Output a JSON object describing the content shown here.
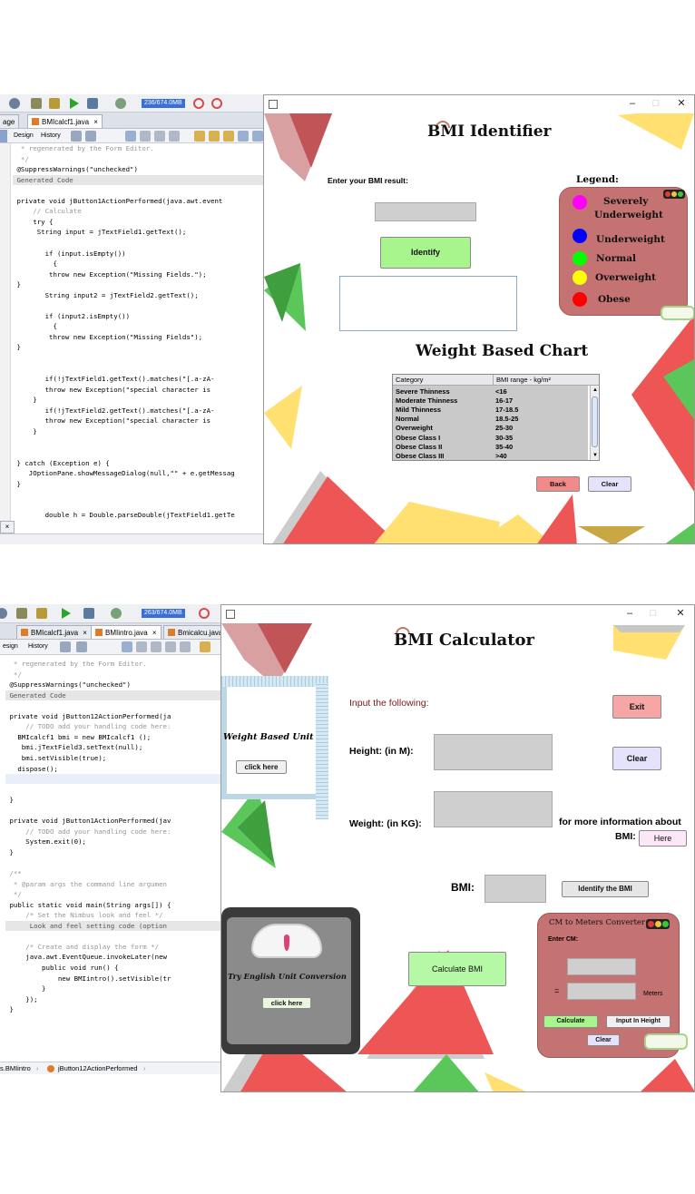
{
  "ide_top": {
    "memory": "236/674.0MB",
    "tab_active": "BMIcalcf1.java",
    "sub_design": "Design",
    "sub_history": "History",
    "tab_prefix": "age",
    "close_glyph": "×",
    "code": [
      {
        "t": "  * regenerated by the Form Editor.",
        "c": "cm"
      },
      {
        "t": "  */",
        "c": "cm"
      },
      {
        "t": " @SuppressWarnings(\"unchecked\")"
      },
      {
        "t": " Generated Code",
        "c": "fold"
      },
      {
        "t": ""
      },
      {
        "t": " private void jButton1ActionPerformed(java.awt.event"
      },
      {
        "t": "     // Calculate",
        "c": "cm"
      },
      {
        "t": "     try {"
      },
      {
        "t": "      String input = jTextField1.getText();"
      },
      {
        "t": ""
      },
      {
        "t": "        if (input.isEmpty())"
      },
      {
        "t": "          {"
      },
      {
        "t": "         throw new Exception(\"Missing Fields.\");"
      },
      {
        "t": " }"
      },
      {
        "t": "        String input2 = jTextField2.getText();"
      },
      {
        "t": ""
      },
      {
        "t": "        if (input2.isEmpty())"
      },
      {
        "t": "          {"
      },
      {
        "t": "         throw new Exception(\"Missing Fields\");"
      },
      {
        "t": " }"
      },
      {
        "t": ""
      },
      {
        "t": ""
      },
      {
        "t": "        if(!jTextField1.getText().matches(\"[.a-zA-"
      },
      {
        "t": "        throw new Exception(\"special character is"
      },
      {
        "t": "     }"
      },
      {
        "t": "        if(!jTextField2.getText().matches(\"[.a-zA-"
      },
      {
        "t": "        throw new Exception(\"special character is"
      },
      {
        "t": "     }"
      },
      {
        "t": ""
      },
      {
        "t": ""
      },
      {
        "t": " } catch (Exception e) {"
      },
      {
        "t": "    JOptionPane.showMessageDialog(null,\"\" + e.getMessag"
      },
      {
        "t": " }"
      },
      {
        "t": ""
      },
      {
        "t": ""
      },
      {
        "t": "        double h = Double.parseDouble(jTextField1.getTe"
      }
    ]
  },
  "ide_bottom": {
    "memory": "263/674.0MB",
    "tabs": [
      "BMIcalcf1.java",
      "BMIintro.java",
      "Bmicalcu.java"
    ],
    "sub_design": "esign",
    "sub_history": "History",
    "breadcrumb_1": "s.BMIintro",
    "breadcrumb_2": "jButton12ActionPerformed",
    "code": [
      {
        "t": "  * regenerated by the Form Editor.",
        "c": "cm"
      },
      {
        "t": "  */",
        "c": "cm"
      },
      {
        "t": " @SuppressWarnings(\"unchecked\")"
      },
      {
        "t": " Generated Code",
        "c": "fold"
      },
      {
        "t": ""
      },
      {
        "t": " private void jButton12ActionPerformed(ja"
      },
      {
        "t": "     // TODO add your handling code here:",
        "c": "cm"
      },
      {
        "t": "   BMIcalcf1 bmi = new BMIcalcf1 ();"
      },
      {
        "t": "    bmi.jTextField3.setText(null);"
      },
      {
        "t": "    bmi.setVisible(true);"
      },
      {
        "t": "   dispose();"
      },
      {
        "t": "",
        "c": "hl"
      },
      {
        "t": ""
      },
      {
        "t": " }"
      },
      {
        "t": ""
      },
      {
        "t": " private void jButton1ActionPerformed(jav"
      },
      {
        "t": "     // TODO add your handling code here:",
        "c": "cm"
      },
      {
        "t": "     System.exit(0);"
      },
      {
        "t": " }"
      },
      {
        "t": ""
      },
      {
        "t": " /**",
        "c": "cm"
      },
      {
        "t": "  * @param args the command line argumen",
        "c": "cm"
      },
      {
        "t": "  */",
        "c": "cm"
      },
      {
        "t": " public static void main(String args[]) {"
      },
      {
        "t": "     /* Set the Nimbus look and feel */",
        "c": "cm"
      },
      {
        "t": "      Look and feel setting code (option",
        "c": "fold"
      },
      {
        "t": ""
      },
      {
        "t": "     /* Create and display the form */",
        "c": "cm"
      },
      {
        "t": "     java.awt.EventQueue.invokeLater(new"
      },
      {
        "t": "         public void run() {"
      },
      {
        "t": "             new BMIintro().setVisible(tr"
      },
      {
        "t": "         }"
      },
      {
        "t": "     });"
      },
      {
        "t": " }"
      }
    ]
  },
  "identifier": {
    "title": "BMI Identifier",
    "prompt": "Enter your BMI result:",
    "identify_btn": "Identify",
    "legend_title": "Legend:",
    "legend": [
      {
        "label": "Severely",
        "label2": "Underweight",
        "color": "#ff00ff"
      },
      {
        "label": "Underweight",
        "color": "#0000ff"
      },
      {
        "label": "Normal",
        "color": "#00ff00"
      },
      {
        "label": "Overweight",
        "color": "#ffff00"
      },
      {
        "label": "Obese",
        "color": "#ff0000"
      }
    ],
    "chart_title": "Weight Based Chart",
    "table_headers": [
      "Category",
      "BMI range - kg/m²"
    ],
    "table_rows": [
      [
        "Severe Thinness",
        "<16"
      ],
      [
        "Moderate Thinness",
        "16-17"
      ],
      [
        "Mild Thinness",
        "17-18.5"
      ],
      [
        "Normal",
        "18.5-25"
      ],
      [
        "Overweight",
        "25-30"
      ],
      [
        "Obese Class I",
        "30-35"
      ],
      [
        "Obese Class II",
        "35-40"
      ],
      [
        "Obese Class III",
        ">40"
      ]
    ],
    "back_btn": "Back",
    "clear_btn": "Clear"
  },
  "calculator": {
    "title": "BMI Calculator",
    "input_label": "Input the following:",
    "exit_btn": "Exit",
    "clear_btn": "Clear",
    "height_label": "Height: (in M):",
    "weight_label": "Weight: (in KG):",
    "more_info": "for more information about",
    "more_info2": "BMI:",
    "here_btn": "Here",
    "bmi_label": "BMI:",
    "identify_btn": "Identify the BMI",
    "calculate_btn": "Calculate BMI",
    "weight_unit_label": "Weight Based Unit",
    "click_here": "click here",
    "english_label": "Try English Unit Conversion",
    "click_here2": "click here",
    "converter": {
      "title": "CM to Meters Converter",
      "enter_cm": "Enter CM:",
      "equals": "=",
      "meters": "Meters",
      "calculate": "Calculate",
      "input_height": "Input In Height",
      "clear": "Clear"
    }
  },
  "colors": {
    "legend_bg": "#c47372",
    "green_btn": "#a9f58d",
    "pink_btn": "#f28a8a",
    "lavender_btn": "#e4e3fb"
  }
}
